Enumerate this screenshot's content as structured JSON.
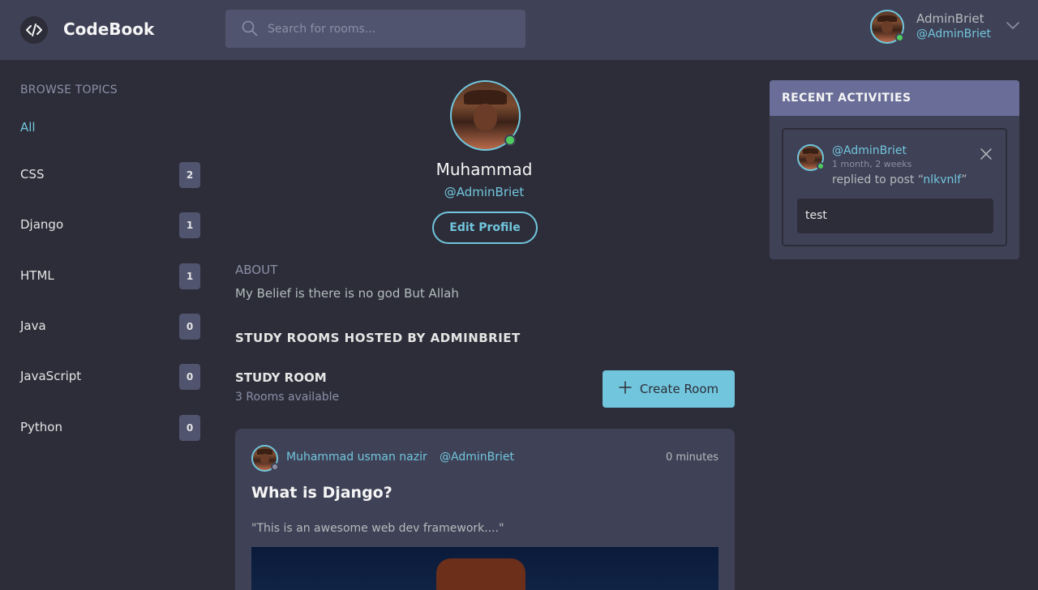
{
  "header": {
    "logo_text": "CodeBook",
    "search_placeholder": "Search for rooms...",
    "user_name": "AdminBriet",
    "user_handle": "@AdminBriet"
  },
  "sidebar": {
    "title": "BROWSE TOPICS",
    "topics": [
      {
        "label": "All",
        "count": ""
      },
      {
        "label": "CSS",
        "count": "2"
      },
      {
        "label": "Django",
        "count": "1"
      },
      {
        "label": "HTML",
        "count": "1"
      },
      {
        "label": "Java",
        "count": "0"
      },
      {
        "label": "JavaScript",
        "count": "0"
      },
      {
        "label": "Python",
        "count": "0"
      }
    ]
  },
  "profile": {
    "name": "Muhammad",
    "handle": "@AdminBriet",
    "edit_label": "Edit Profile",
    "about_title": "ABOUT",
    "about_text": "My Belief is there is no god But Allah"
  },
  "rooms": {
    "hosted_title": "STUDY ROOMS HOSTED BY ADMINBRIET",
    "section_title": "STUDY ROOM",
    "available": "3 Rooms available",
    "create_label": "Create Room"
  },
  "room_card": {
    "author": "Muhammad usman nazir",
    "handle": "@AdminBriet",
    "time": "0 minutes",
    "title": "What is Django?",
    "description": "\"This is an awesome web dev framework....\""
  },
  "activities": {
    "title": "RECENT ACTIVITIES",
    "handle": "@AdminBriet",
    "time": "1 month, 2 weeks",
    "action": "replied to post “",
    "post": "nlkvnlf",
    "action_end": "”",
    "reply": "test"
  },
  "colors": {
    "background": "#2d2d39",
    "panel": "#3f4156",
    "accent": "#71c6dd",
    "muted": "#8b8fa7",
    "activities_header": "#696d97",
    "online": "#4ecc5f"
  }
}
